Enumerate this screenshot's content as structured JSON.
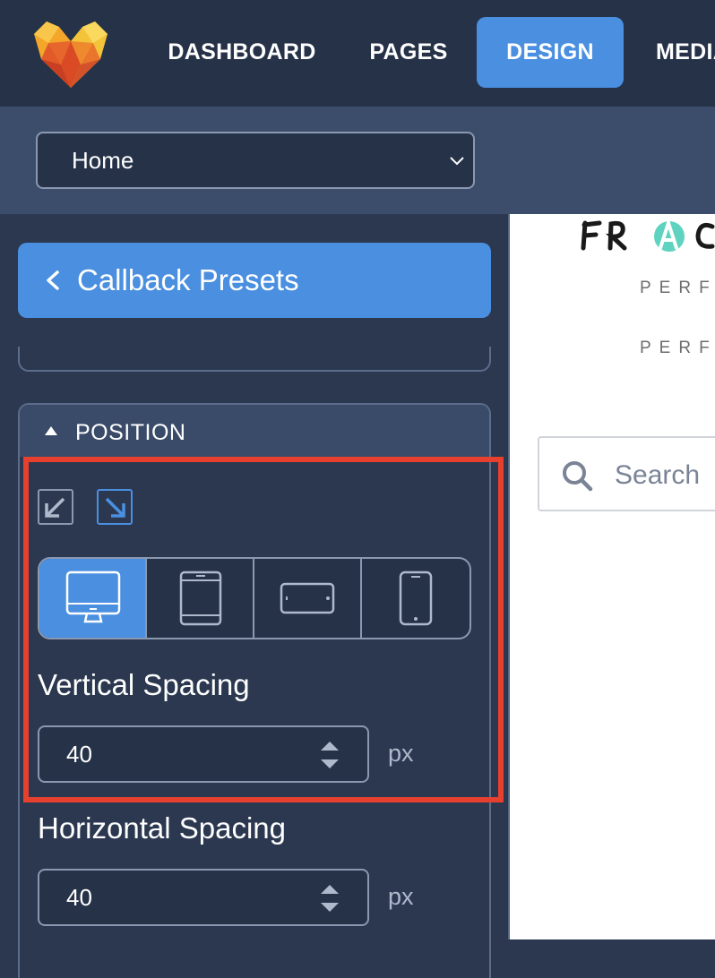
{
  "nav": {
    "items": [
      {
        "label": "DASHBOARD",
        "active": false
      },
      {
        "label": "PAGES",
        "active": false
      },
      {
        "label": "DESIGN",
        "active": true
      },
      {
        "label": "MEDIA",
        "active": false
      }
    ]
  },
  "page_select": {
    "value": "Home"
  },
  "panel": {
    "back_label": "Callback Presets",
    "section_title": "POSITION",
    "alignment": {
      "selected": "bottom-right"
    },
    "devices": [
      {
        "name": "desktop",
        "active": true
      },
      {
        "name": "tablet-portrait",
        "active": false
      },
      {
        "name": "tablet-landscape",
        "active": false
      },
      {
        "name": "phone",
        "active": false
      }
    ],
    "vertical_spacing": {
      "label": "Vertical Spacing",
      "value": "40",
      "unit": "px"
    },
    "horizontal_spacing": {
      "label": "Horizontal Spacing",
      "value": "40",
      "unit": "px"
    }
  },
  "preview": {
    "tagline_1": "PERF",
    "tagline_2": "PERF",
    "search_placeholder": "Search"
  },
  "colors": {
    "accent": "#4a8fe0",
    "nav_bg": "#263248",
    "panel_bg": "#2b3850",
    "highlight": "#e8402f"
  }
}
